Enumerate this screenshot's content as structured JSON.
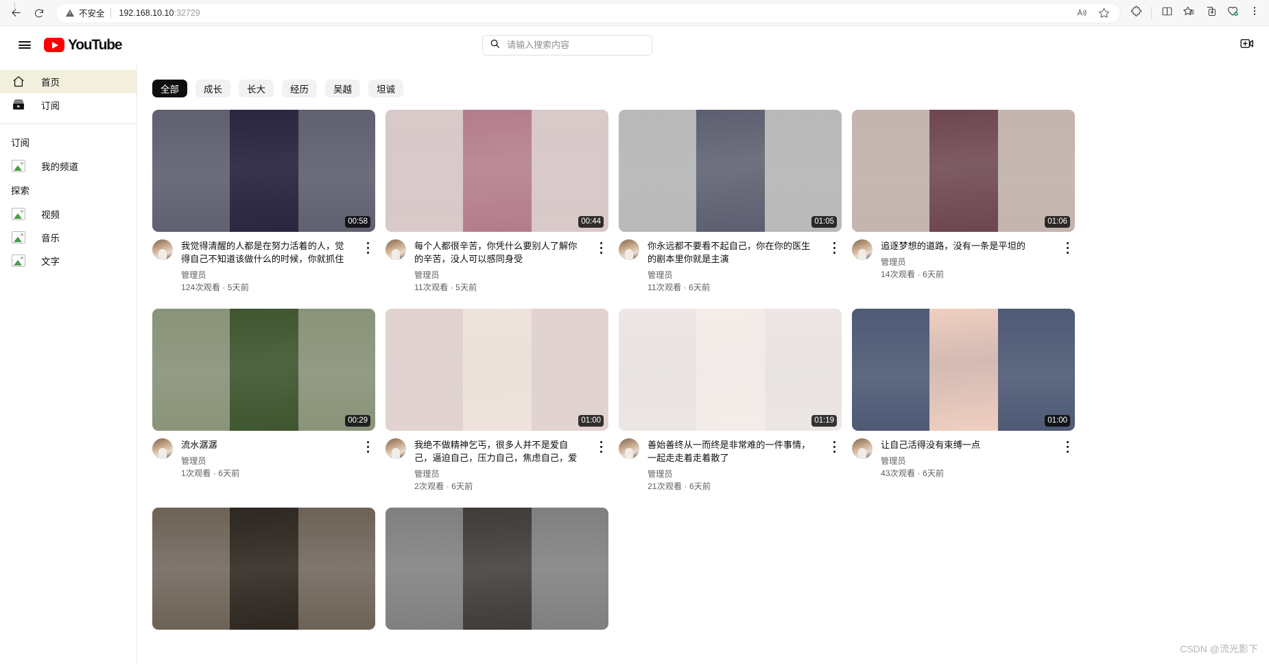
{
  "browser": {
    "back_title": "后退",
    "refresh_title": "刷新",
    "security_label": "不安全",
    "url_host": "192.168.10.10",
    "url_port": ":32729",
    "icons": {
      "back": "back-arrow-icon",
      "refresh": "refresh-icon",
      "warning": "warning-triangle-icon",
      "read_aloud": "read-aloud-icon",
      "favorite": "favorite-star-icon",
      "extensions": "extensions-puzzle-icon",
      "split_screen": "split-screen-icon",
      "collections": "collections-star-icon",
      "add_tab_group": "add-to-collection-icon",
      "browser_essentials": "browser-essentials-icon",
      "settings_more": "more-options-icon"
    }
  },
  "header": {
    "menu_label": "菜单",
    "logo_text": "YouTube",
    "search": {
      "placeholder": "请输入搜索内容",
      "value": ""
    },
    "create_label": "创建"
  },
  "sidebar": {
    "primary": [
      {
        "label": "首页",
        "icon": "home-icon",
        "active": true
      },
      {
        "label": "订阅",
        "icon": "subscriptions-icon",
        "active": false
      }
    ],
    "sections": [
      {
        "heading": "订阅",
        "items": [
          {
            "label": "我的频道",
            "icon": "broken-image-icon"
          }
        ]
      },
      {
        "heading": "探索",
        "items": [
          {
            "label": "视频",
            "icon": "broken-image-icon"
          },
          {
            "label": "音乐",
            "icon": "broken-image-icon"
          },
          {
            "label": "文字",
            "icon": "broken-image-icon"
          }
        ]
      }
    ]
  },
  "chips": [
    {
      "label": "全部",
      "active": true
    },
    {
      "label": "成长",
      "active": false
    },
    {
      "label": "长大",
      "active": false
    },
    {
      "label": "经历",
      "active": false
    },
    {
      "label": "吴越",
      "active": false
    },
    {
      "label": "坦诚",
      "active": false
    }
  ],
  "videos": [
    {
      "title": "我觉得清醒的人都是在努力活着的人，觉得自己不知道该做什么的时候，你就抓住一…",
      "channel": "管理员",
      "stats": "124次观看 · 5天前",
      "duration": "00:58",
      "thumb_side": "#5f6070",
      "thumb_center": "#2a2640"
    },
    {
      "title": "每个人都很辛苦，你凭什么要别人了解你的辛苦，没人可以感同身受",
      "channel": "管理员",
      "stats": "11次观看 · 5天前",
      "duration": "00:44",
      "thumb_side": "#d9c9c9",
      "thumb_center": "#b47c8b"
    },
    {
      "title": "你永远都不要看不起自己，你在你的医生的剧本里你就是主演",
      "channel": "管理员",
      "stats": "11次观看 · 6天前",
      "duration": "01:05",
      "thumb_side": "#b9b9b9",
      "thumb_center": "#5c5f70"
    },
    {
      "title": "追逐梦想的道路，没有一条是平坦的",
      "channel": "管理员",
      "stats": "14次观看 · 6天前",
      "duration": "01:06",
      "thumb_side": "#c4b5ae",
      "thumb_center": "#6d4550"
    },
    {
      "title": "流水潺潺",
      "channel": "管理员",
      "stats": "1次观看 · 6天前",
      "duration": "00:29",
      "thumb_side": "#8a9479",
      "thumb_center": "#3f5630"
    },
    {
      "title": "我绝不做精神乞丐，很多人并不是爱自己，逼迫自己，压力自己，焦虑自己，爱自己…",
      "channel": "管理员",
      "stats": "2次观看 · 6天前",
      "duration": "01:00",
      "thumb_side": "#e2d3d0",
      "thumb_center": "#efe3dd"
    },
    {
      "title": "善始善终从一而终是非常难的一件事情，一起走走着走着散了",
      "channel": "管理员",
      "stats": "21次观看 · 6天前",
      "duration": "01:19",
      "thumb_side": "#ece6e4",
      "thumb_center": "#f3ece9"
    },
    {
      "title": "让自己活得没有束缚一点",
      "channel": "管理员",
      "stats": "43次观看 · 6天前",
      "duration": "01:00",
      "thumb_side": "#4f5a76",
      "thumb_center": "#f0cfc0"
    }
  ],
  "partial_row": [
    {
      "thumb_side": "#6e6257",
      "thumb_center": "#2e2822"
    },
    {
      "thumb_side": "#7f7f7f",
      "thumb_center": "#403c38"
    }
  ],
  "watermark": "CSDN @流光影下",
  "colors": {
    "brand_red": "#FF0000",
    "active_nav_bg": "#f2efdc",
    "chip_active_bg": "#0f0f0f",
    "text_primary": "#0f0f0f",
    "text_secondary": "#606060"
  }
}
